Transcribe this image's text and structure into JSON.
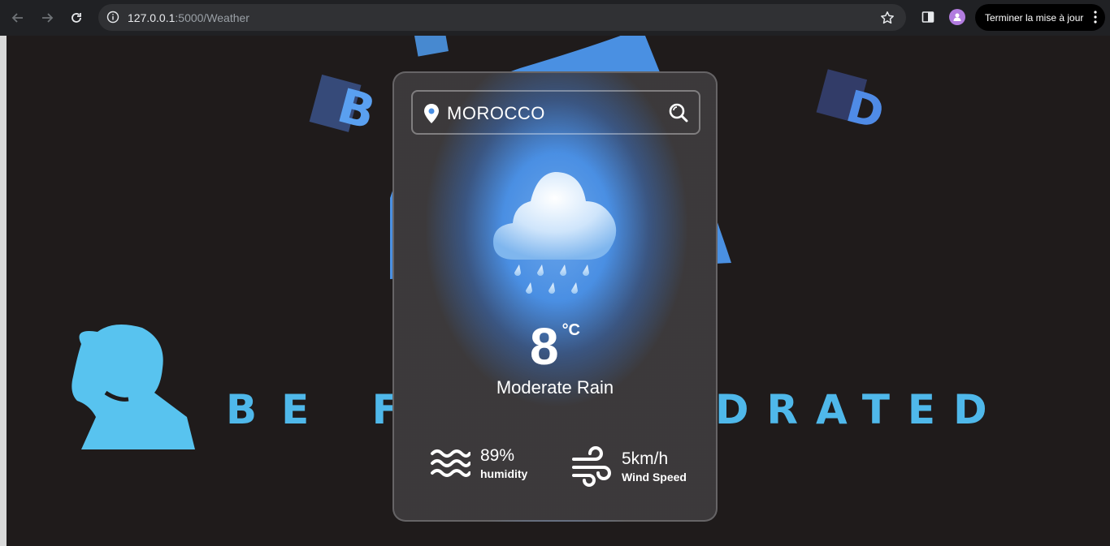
{
  "browser": {
    "url_host": "127.0.0.1",
    "url_path": ":5000/Weather",
    "update_button_label": "Terminer la mise à jour"
  },
  "background": {
    "banner_text_left": "BE FO",
    "banner_text_right": "DRATED",
    "logo_letter_left": "B",
    "logo_letter_right": "D"
  },
  "weather": {
    "search": {
      "value": "MOROCCO"
    },
    "icon": "rain-cloud-icon",
    "temperature": "8",
    "unit": "°C",
    "description": "Moderate Rain",
    "humidity": {
      "value": "89%",
      "label": "humidity",
      "icon": "waves-icon"
    },
    "wind": {
      "value": "5km/h",
      "label": "Wind Speed",
      "icon": "wind-icon"
    }
  },
  "colors": {
    "accent_blue": "#4a8fe3",
    "brand_cyan": "#4fc3f7",
    "chrome_bg": "#202124"
  }
}
